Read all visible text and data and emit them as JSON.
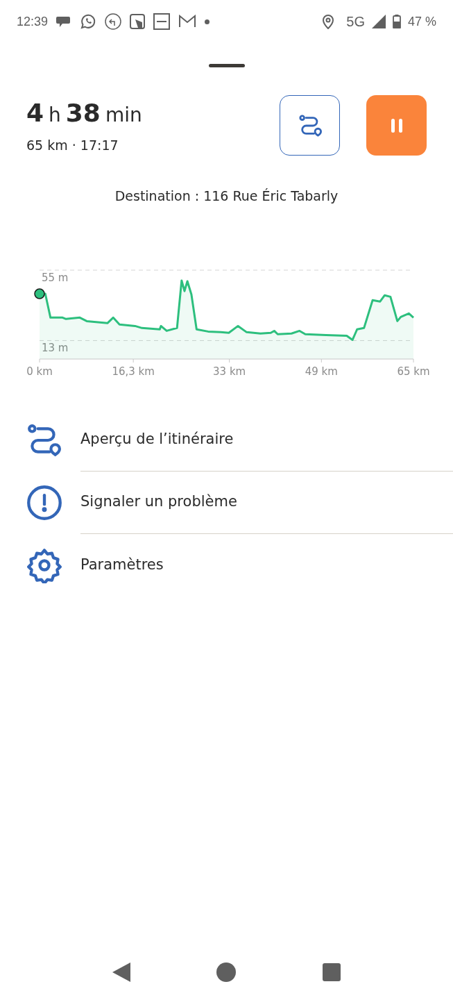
{
  "status_bar": {
    "time": "12:39",
    "network": "5G",
    "battery": "47 %"
  },
  "trip": {
    "hours": "4",
    "hours_unit": "h",
    "minutes": "38",
    "minutes_unit": "min",
    "subtitle": "65 km · 17:17"
  },
  "destination": "Destination : 116 Rue Éric Tabarly",
  "elevation": {
    "chart_data": {
      "type": "area",
      "x": [
        0,
        1.0,
        1.9,
        4.0,
        4.6,
        7.0,
        8.2,
        11.8,
        12.8,
        13.9,
        16.6,
        17.8,
        20.9,
        21.1,
        22.1,
        23.9,
        24.7,
        25.2,
        25.7,
        26.4,
        27.3,
        29.3,
        31.5,
        32.9,
        34.5,
        36.0,
        38.4,
        40.2,
        40.8,
        41.4,
        43.8,
        45.2,
        46.2,
        49.8,
        53.4,
        54.4,
        55.2,
        56.4,
        57.9,
        59.2,
        60.0,
        61.0,
        62.2,
        62.8,
        64.2,
        65
      ],
      "series": [
        {
          "color": "#2dbf7e",
          "values": [
            40.9,
            40.9,
            26.7,
            26.7,
            25.9,
            26.7,
            24.6,
            23.4,
            26.7,
            22.6,
            21.7,
            20.5,
            19.7,
            21.7,
            18.8,
            20.5,
            48.8,
            42.5,
            48.4,
            40.5,
            19.7,
            18.4,
            18.0,
            17.6,
            21.7,
            18.0,
            17.2,
            17.6,
            18.8,
            16.8,
            17.2,
            18.8,
            16.8,
            16.3,
            15.9,
            13.4,
            19.7,
            20.5,
            37.1,
            36.3,
            40.0,
            39.1,
            24.6,
            27.1,
            29.2,
            26.7
          ]
        }
      ],
      "xlim": [
        0,
        65
      ],
      "ylim": [
        2,
        55
      ],
      "xticks": [
        {
          "value": 0,
          "label": "0 km"
        },
        {
          "value": 16.3,
          "label": "16,3 km"
        },
        {
          "value": 33,
          "label": "33 km"
        },
        {
          "value": 49,
          "label": "49 km"
        },
        {
          "value": 65,
          "label": "65 km"
        }
      ],
      "yticks": [
        {
          "value": 13,
          "label": "13 m"
        },
        {
          "value": 55,
          "label": "55 m"
        }
      ]
    }
  },
  "menu": [
    {
      "kind": "route",
      "label": "Aperçu de l’itinéraire"
    },
    {
      "kind": "report",
      "label": "Signaler un problème"
    },
    {
      "kind": "settings",
      "label": "Paramètres"
    }
  ]
}
